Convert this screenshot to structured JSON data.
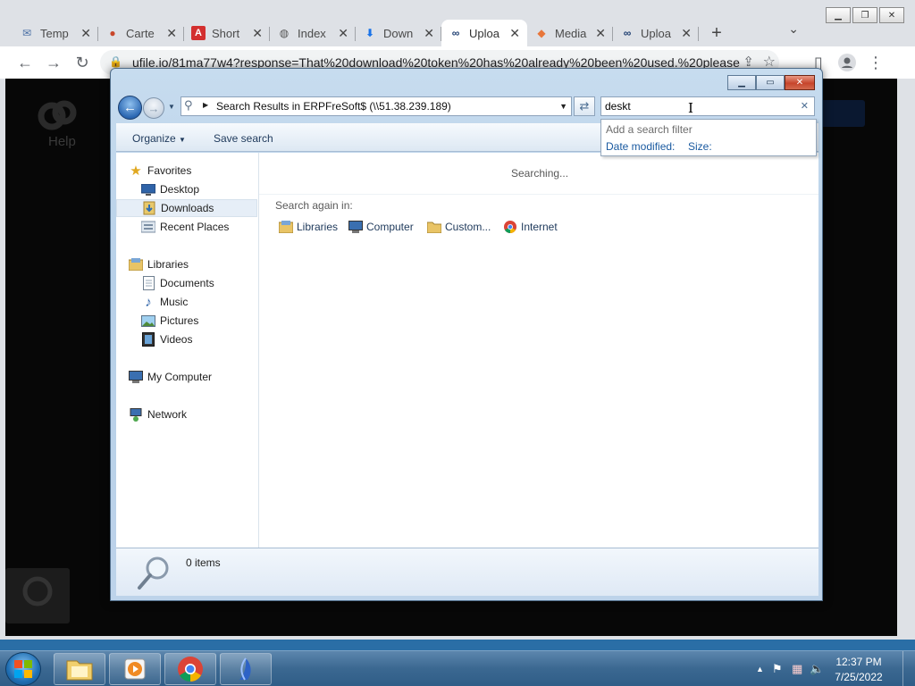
{
  "browser": {
    "tabs": [
      {
        "title": "Temp",
        "icon": "mail-icon",
        "color": "#4a6fa5"
      },
      {
        "title": "Carte",
        "icon": "burger-icon",
        "color": "#c8472b"
      },
      {
        "title": "Short",
        "icon": "pdf-icon",
        "color": "#d32f2f"
      },
      {
        "title": "Index",
        "icon": "globe-icon",
        "color": "#555555"
      },
      {
        "title": "Down",
        "icon": "download-icon",
        "color": "#1a73e8"
      },
      {
        "title": "Uploa",
        "icon": "ufile-icon",
        "color": "#1c3d70"
      },
      {
        "title": "Media",
        "icon": "diamond-icon",
        "color": "#e8763a"
      },
      {
        "title": "Uploa",
        "icon": "ufile-icon",
        "color": "#1c3d70"
      }
    ],
    "active_tab": 5,
    "url": "ufile.io/81ma77w4?response=That%20download%20token%20has%20already%20been%20used.%20please...",
    "page_help": "Help"
  },
  "explorer": {
    "address_path": "Search Results in ERPFreSoft$ (\\\\51.38.239.189)",
    "search_value": "deskt",
    "commands": {
      "organize": "Organize",
      "save_search": "Save search"
    },
    "suggest": {
      "header": "Add a search filter",
      "filter1": "Date modified:",
      "filter2": "Size:"
    },
    "nav": {
      "favorites": "Favorites",
      "desktop": "Desktop",
      "downloads": "Downloads",
      "recent": "Recent Places",
      "libraries": "Libraries",
      "documents": "Documents",
      "music": "Music",
      "pictures": "Pictures",
      "videos": "Videos",
      "computer": "My Computer",
      "network": "Network"
    },
    "status": "Searching...",
    "search_again_label": "Search again in:",
    "search_again": [
      "Libraries",
      "Computer",
      "Custom...",
      "Internet"
    ],
    "item_count": "0 items"
  },
  "taskbar": {
    "time": "12:37 PM",
    "date": "7/25/2022"
  },
  "colors": {
    "windows_blue": "#2c68b3",
    "link": "#1a5aa0"
  }
}
